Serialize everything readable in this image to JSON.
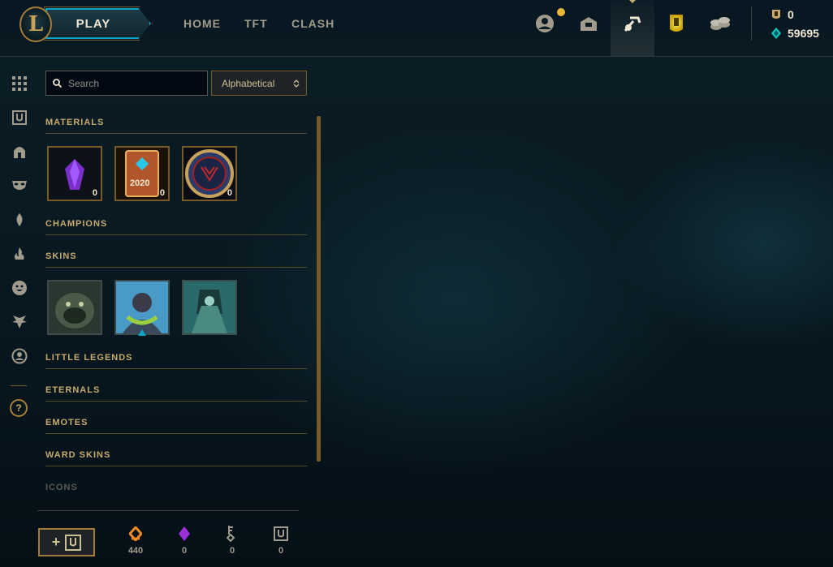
{
  "topbar": {
    "logo_letter": "L",
    "play_label": "PLAY",
    "nav": [
      "HOME",
      "TFT",
      "CLASH"
    ],
    "icons": [
      "profile-icon",
      "collection-icon",
      "loot-icon",
      "store-icon",
      "currency-icon"
    ],
    "currency": {
      "mythic_essence": "0",
      "blue_essence": "59695"
    }
  },
  "sidenav": {
    "icons": [
      "all-grid-icon",
      "chest-icon",
      "champion-helmet-icon",
      "mask-icon",
      "leaf-icon",
      "fire-icon",
      "emote-face-icon",
      "little-legend-icon",
      "profile-circle-icon"
    ],
    "help_label": "?"
  },
  "search": {
    "placeholder": "Search",
    "value": ""
  },
  "sort": {
    "label": "Alphabetical",
    "arrow": "⌃⌄"
  },
  "sections": {
    "materials": "MATERIALS",
    "champions": "CHAMPIONS",
    "skins": "SKINS",
    "little_legends": "LITTLE LEGENDS",
    "eternals": "ETERNALS",
    "emotes": "EMOTES",
    "ward_skins": "WARD SKINS",
    "icons": "ICONS"
  },
  "materials": [
    {
      "name": "gemstone",
      "count": "0",
      "label": ""
    },
    {
      "name": "event-pass-2020",
      "count": "0",
      "label": "2020"
    },
    {
      "name": "worlds-token",
      "count": "0",
      "label": ""
    }
  ],
  "skins": [
    "skin-1",
    "skin-2",
    "skin-3"
  ],
  "bottom": {
    "add_label": "+",
    "stats": [
      {
        "name": "orange-essence",
        "value": "440",
        "color": "#f08a24"
      },
      {
        "name": "gemstone",
        "value": "0",
        "color": "#9b30d9"
      },
      {
        "name": "key-fragment",
        "value": "0",
        "color": "#a09b8c"
      },
      {
        "name": "chest",
        "value": "0",
        "color": "#a09b8c"
      }
    ]
  },
  "colors": {
    "gold": "#c8aa6e",
    "teal": "#0aa3c6",
    "bg": "#010a13"
  }
}
